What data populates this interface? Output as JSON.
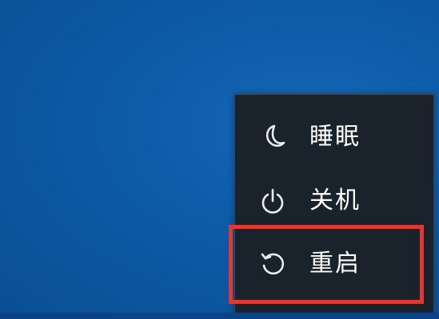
{
  "power_menu": {
    "items": [
      {
        "label": "睡眠",
        "icon": "moon-icon"
      },
      {
        "label": "关机",
        "icon": "power-icon"
      },
      {
        "label": "重启",
        "icon": "restart-icon"
      }
    ],
    "highlighted_item": "重启"
  },
  "colors": {
    "desktop_background": "#0d5aa6",
    "menu_background": "#1a222b",
    "menu_text": "#ffffff",
    "highlight_border": "#e0392f"
  }
}
